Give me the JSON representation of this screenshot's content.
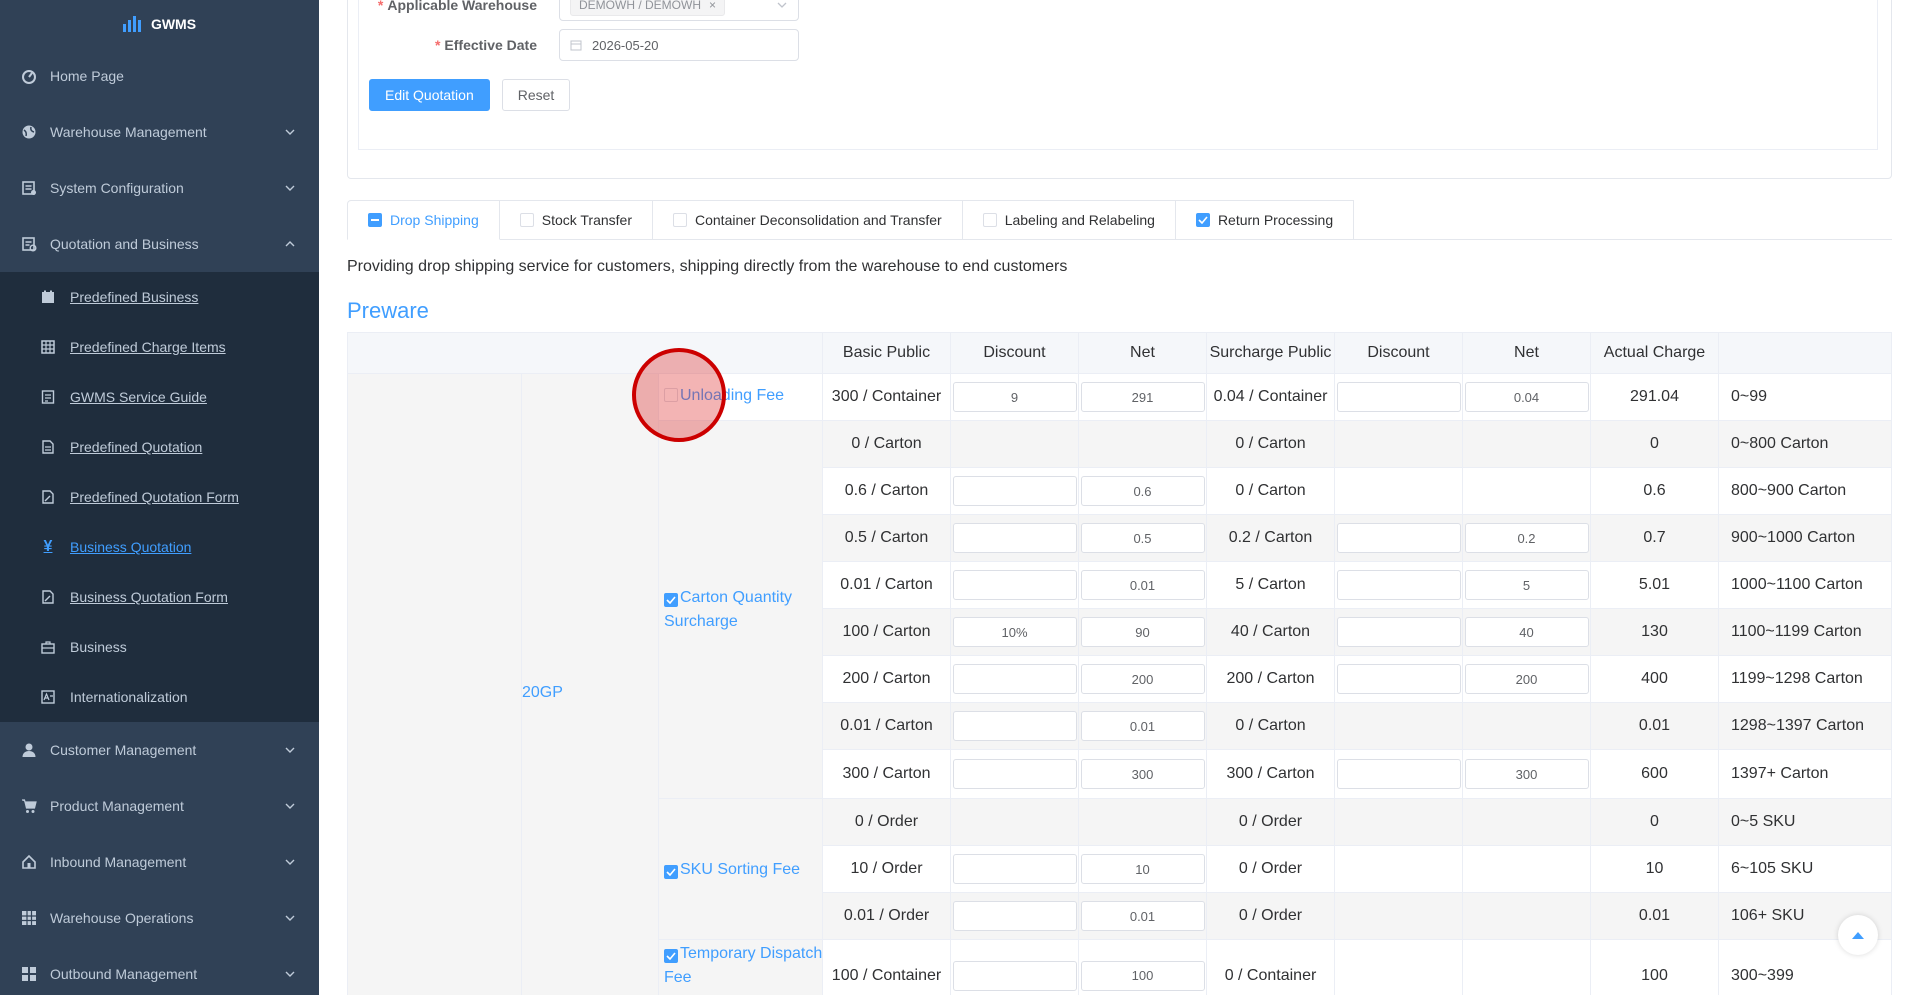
{
  "app": {
    "name": "GWMS"
  },
  "sidebar": {
    "items": [
      {
        "label": "Home Page",
        "icon": "dashboard-icon"
      },
      {
        "label": "Warehouse Management",
        "icon": "globe-icon"
      },
      {
        "label": "System Configuration",
        "icon": "config-icon"
      },
      {
        "label": "Quotation and Business",
        "icon": "quotation-icon"
      }
    ],
    "subitems": [
      {
        "label": "Predefined Business",
        "icon": "calendar-icon"
      },
      {
        "label": "Predefined Charge Items",
        "icon": "table-icon"
      },
      {
        "label": "GWMS Service Guide",
        "icon": "guide-icon"
      },
      {
        "label": "Predefined Quotation",
        "icon": "document-icon"
      },
      {
        "label": "Predefined Quotation Form",
        "icon": "edit-document-icon"
      },
      {
        "label": "Business Quotation",
        "icon": "yen-icon"
      },
      {
        "label": "Business Quotation Form",
        "icon": "edit-document-icon"
      },
      {
        "label": "Business",
        "icon": "briefcase-icon"
      },
      {
        "label": "Internationalization",
        "icon": "language-icon"
      }
    ],
    "lower_items": [
      {
        "label": "Customer Management",
        "icon": "user-icon"
      },
      {
        "label": "Product Management",
        "icon": "cart-icon"
      },
      {
        "label": "Inbound Management",
        "icon": "home-icon"
      },
      {
        "label": "Warehouse Operations",
        "icon": "grid-icon"
      },
      {
        "label": "Outbound Management",
        "icon": "apps-icon"
      }
    ]
  },
  "form": {
    "warehouse_label": "Applicable Warehouse",
    "warehouse_tag": "DEMOWH / DEMOWH",
    "date_label": "Effective Date",
    "date_value": "2026-05-20",
    "edit_button": "Edit Quotation",
    "reset_button": "Reset"
  },
  "tabs": [
    {
      "label": "Drop Shipping",
      "state": "indeterminate",
      "active": true
    },
    {
      "label": "Stock Transfer",
      "state": "unchecked"
    },
    {
      "label": "Container Deconsolidation and Transfer",
      "state": "unchecked"
    },
    {
      "label": "Labeling and Relabeling",
      "state": "unchecked"
    },
    {
      "label": "Return Processing",
      "state": "checked"
    }
  ],
  "description": "Providing drop shipping service for customers, shipping directly from the warehouse to end customers",
  "section_title": "Preware",
  "table": {
    "headers": [
      "Basic Public",
      "Discount",
      "Net",
      "Surcharge Public",
      "Discount",
      "Net",
      "Actual Charge"
    ],
    "container_type": "20GP",
    "fees": [
      {
        "name": "Unloading Fee",
        "checked": false
      },
      {
        "name": "Carton Quantity Surcharge",
        "checked": true
      },
      {
        "name": "SKU Sorting Fee",
        "checked": true
      },
      {
        "name": "Temporary Dispatch Fee",
        "checked": true
      }
    ],
    "rows": [
      {
        "basic": "300 / Container",
        "disc": "9",
        "net": "291",
        "sur": "0.04 / Container",
        "sdisc": "",
        "snet": "0.04",
        "actual": "291.04",
        "range": "0~99",
        "inputs": [
          true,
          true,
          true,
          true
        ]
      },
      {
        "basic": "0 / Carton",
        "disc": "",
        "net": "",
        "sur": "0 / Carton",
        "sdisc": "",
        "snet": "",
        "actual": "0",
        "range": "0~800 Carton",
        "inputs": [
          false,
          false,
          false,
          false
        ]
      },
      {
        "basic": "0.6 / Carton",
        "disc": "",
        "net": "0.6",
        "sur": "0 / Carton",
        "sdisc": "",
        "snet": "",
        "actual": "0.6",
        "range": "800~900 Carton",
        "inputs": [
          true,
          true,
          false,
          false
        ]
      },
      {
        "basic": "0.5 / Carton",
        "disc": "",
        "net": "0.5",
        "sur": "0.2 / Carton",
        "sdisc": "",
        "snet": "0.2",
        "actual": "0.7",
        "range": "900~1000 Carton",
        "inputs": [
          true,
          true,
          true,
          true
        ]
      },
      {
        "basic": "0.01 / Carton",
        "disc": "",
        "net": "0.01",
        "sur": "5 / Carton",
        "sdisc": "",
        "snet": "5",
        "actual": "5.01",
        "range": "1000~1100 Carton",
        "inputs": [
          true,
          true,
          true,
          true
        ]
      },
      {
        "basic": "100 / Carton",
        "disc": "10%",
        "net": "90",
        "sur": "40 / Carton",
        "sdisc": "",
        "snet": "40",
        "actual": "130",
        "range": "1100~1199 Carton",
        "inputs": [
          true,
          true,
          true,
          true
        ]
      },
      {
        "basic": "200 / Carton",
        "disc": "",
        "net": "200",
        "sur": "200 / Carton",
        "sdisc": "",
        "snet": "200",
        "actual": "400",
        "range": "1199~1298 Carton",
        "inputs": [
          true,
          true,
          true,
          true
        ]
      },
      {
        "basic": "0.01 / Carton",
        "disc": "",
        "net": "0.01",
        "sur": "0 / Carton",
        "sdisc": "",
        "snet": "",
        "actual": "0.01",
        "range": "1298~1397 Carton",
        "inputs": [
          true,
          true,
          false,
          false
        ]
      },
      {
        "basic": "300 / Carton",
        "disc": "",
        "net": "300",
        "sur": "300 / Carton",
        "sdisc": "",
        "snet": "300",
        "actual": "600",
        "range": "1397+ Carton",
        "inputs": [
          true,
          true,
          true,
          true
        ]
      },
      {
        "basic": "0 / Order",
        "disc": "",
        "net": "",
        "sur": "0 / Order",
        "sdisc": "",
        "snet": "",
        "actual": "0",
        "range": "0~5 SKU",
        "inputs": [
          false,
          false,
          false,
          false
        ]
      },
      {
        "basic": "10 / Order",
        "disc": "",
        "net": "10",
        "sur": "0 / Order",
        "sdisc": "",
        "snet": "",
        "actual": "10",
        "range": "6~105 SKU",
        "inputs": [
          true,
          true,
          false,
          false
        ]
      },
      {
        "basic": "0.01 / Order",
        "disc": "",
        "net": "0.01",
        "sur": "0 / Order",
        "sdisc": "",
        "snet": "",
        "actual": "0.01",
        "range": "106+ SKU",
        "inputs": [
          true,
          true,
          false,
          false
        ]
      },
      {
        "basic": "100 / Container",
        "disc": "",
        "net": "100",
        "sur": "0 / Container",
        "sdisc": "",
        "snet": "",
        "actual": "100",
        "range": "300~399",
        "inputs": [
          true,
          true,
          false,
          false
        ]
      }
    ]
  }
}
